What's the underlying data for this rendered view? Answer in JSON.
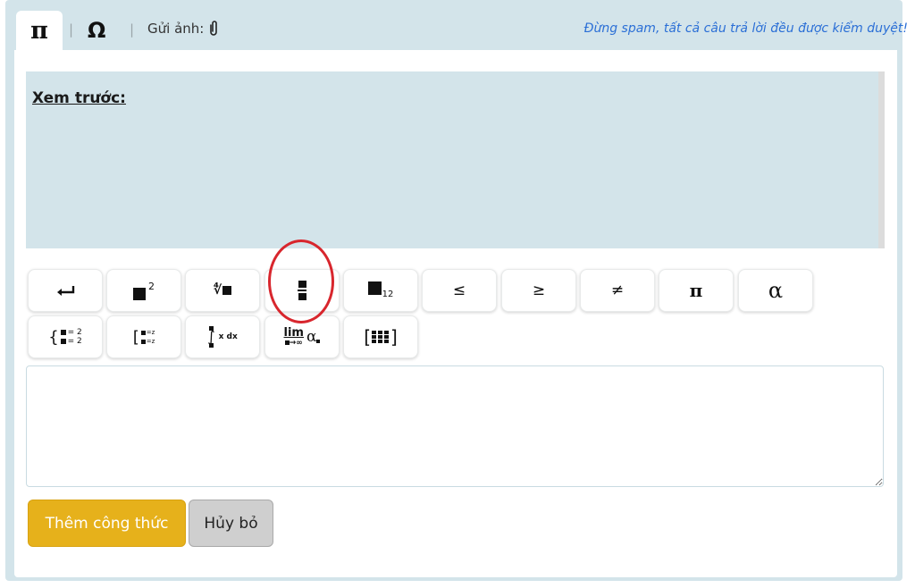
{
  "toolbar": {
    "tab_pi_icon": "pi-symbol",
    "tab_omega_icon": "omega-symbol",
    "tab_pi_glyph": "π",
    "tab_omega_glyph": "Ω",
    "separator": "|",
    "upload_label": "Gửi ảnh:",
    "upload_icon": "paperclip-icon",
    "notice": "Đừng spam, tất cả câu trả lời đều được kiểm duyệt!"
  },
  "preview": {
    "label": "Xem trước:"
  },
  "symbol_buttons_row1": [
    {
      "name": "newline",
      "icon": "enter-arrow-icon"
    },
    {
      "name": "superscript",
      "icon": "superscript-icon",
      "sup": "2"
    },
    {
      "name": "root",
      "icon": "nth-root-icon",
      "text": "∜"
    },
    {
      "name": "fraction",
      "icon": "fraction-icon",
      "highlighted": true
    },
    {
      "name": "subscript",
      "icon": "subscript-icon",
      "sub": "12"
    },
    {
      "name": "leq",
      "text": "≤"
    },
    {
      "name": "geq",
      "text": "≥"
    },
    {
      "name": "neq",
      "text": "≠"
    },
    {
      "name": "pi",
      "text": "π"
    },
    {
      "name": "alpha",
      "text": "α"
    }
  ],
  "symbol_buttons_row2": [
    {
      "name": "system-of-equations",
      "icon": "brace-system-icon",
      "lines": [
        "= 2",
        "= 2"
      ]
    },
    {
      "name": "bracket-system",
      "icon": "bracket-system-icon",
      "lines": [
        "=z",
        "=z"
      ]
    },
    {
      "name": "integral",
      "icon": "integral-icon",
      "text": "x dx"
    },
    {
      "name": "limit",
      "icon": "limit-icon",
      "lim": "lim",
      "sub": "→∞",
      "alpha": "α"
    },
    {
      "name": "matrix",
      "icon": "matrix-icon"
    }
  ],
  "actions": {
    "add_formula": "Thêm công thức",
    "cancel": "Hủy bỏ"
  },
  "colors": {
    "panel": "#d3e4ea",
    "notice_text": "#2b6fd6",
    "add_button": "#e6b11b",
    "cancel_button": "#cfcfcf",
    "highlight_circle": "#d8262d"
  }
}
